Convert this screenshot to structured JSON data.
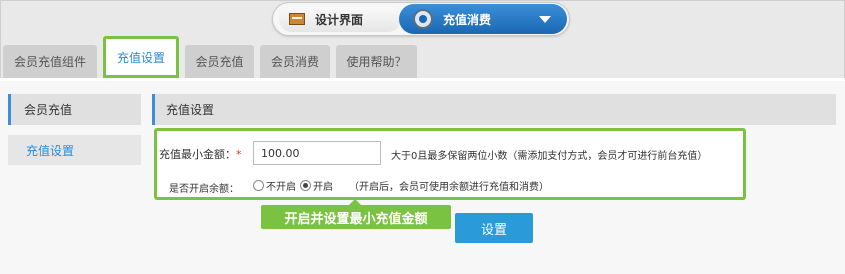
{
  "switcher": {
    "design_label": "设计界面",
    "recharge_label": "充值消费",
    "icons": {
      "design": "design-board-icon",
      "recharge": "gear-icon",
      "dropdown": "chevron-down-icon"
    }
  },
  "tabs": [
    {
      "label": "会员充值组件",
      "active": false
    },
    {
      "label": "充值设置",
      "active": true
    },
    {
      "label": "会员充值",
      "active": false
    },
    {
      "label": "会员消费",
      "active": false
    },
    {
      "label": "使用帮助？",
      "active": false
    }
  ],
  "sidebar": {
    "title": "会员充值",
    "items": [
      {
        "label": "充值设置",
        "active": true
      }
    ]
  },
  "main": {
    "title": "充值设置",
    "form": {
      "min_amount_label": "充值最小金额：",
      "required_mark": "*",
      "min_amount_value": "100.00",
      "min_amount_hint": "大于0且最多保留两位小数（需添加支付方式，会员才可进行前台充值）",
      "balance_label": "是否开启余额：",
      "balance_options": [
        {
          "label": "不开启",
          "checked": false
        },
        {
          "label": "开启",
          "checked": true
        }
      ],
      "balance_hint": "（开启后，会员可使用余额进行充值和消费）"
    },
    "callout": "开启并设置最小充值金额",
    "submit_label": "设置"
  },
  "colors": {
    "accent_blue": "#2a9ad8",
    "highlight_green": "#7ac241",
    "required_red": "#e0302a"
  }
}
